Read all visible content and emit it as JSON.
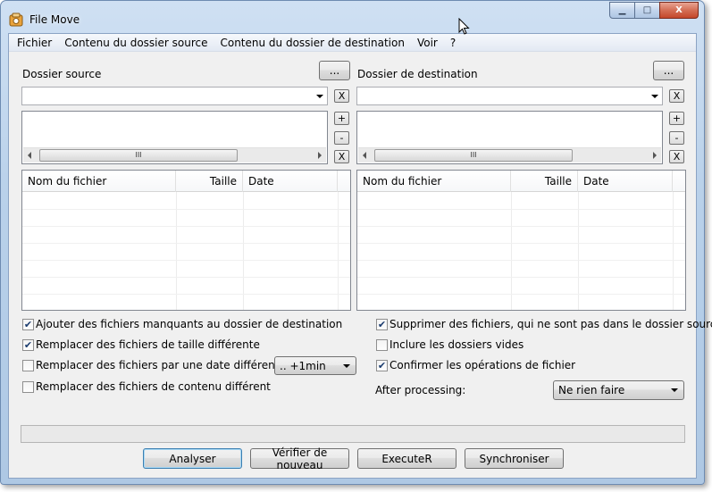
{
  "window": {
    "title": "File Move",
    "controls": {
      "minimize": "▁",
      "maximize": "□",
      "close": "X"
    }
  },
  "menu": [
    "Fichier",
    "Contenu du dossier source",
    "Contenu du dossier de destination",
    "Voir",
    "?"
  ],
  "source": {
    "label": "Dossier source",
    "browse": "...",
    "path_value": "",
    "clear": "X",
    "add": "+",
    "remove": "-",
    "clear_list": "X",
    "scroll_grip": "III",
    "columns": [
      "Nom du fichier",
      "Taille",
      "Date"
    ]
  },
  "destination": {
    "label": "Dossier de destination",
    "browse": "...",
    "path_value": "",
    "clear": "X",
    "add": "+",
    "remove": "-",
    "clear_list": "X",
    "scroll_grip": "III",
    "columns": [
      "Nom du fichier",
      "Taille",
      "Date"
    ]
  },
  "options_left": [
    {
      "label": "Ajouter des fichiers manquants au dossier de destination",
      "checked": true
    },
    {
      "label": "Remplacer des fichiers de taille différente",
      "checked": true
    },
    {
      "label": "Remplacer des fichiers par une date différente",
      "checked": false
    },
    {
      "label": "Remplacer des fichiers de contenu différent",
      "checked": false
    }
  ],
  "date_tolerance": ".. +1min",
  "options_right": [
    {
      "label": "Supprimer des fichiers, qui ne sont pas dans le dossier source",
      "checked": true
    },
    {
      "label": "Inclure les dossiers vides",
      "checked": false
    },
    {
      "label": "Confirmer les opérations de fichier",
      "checked": true
    }
  ],
  "after_processing": {
    "label": "After processing:",
    "value": "Ne rien faire"
  },
  "buttons": {
    "analyze": "Analyser",
    "recheck": "Vérifier de nouveau",
    "execute": "ExecuteR",
    "sync": "Synchroniser"
  },
  "check_mark": "✔"
}
